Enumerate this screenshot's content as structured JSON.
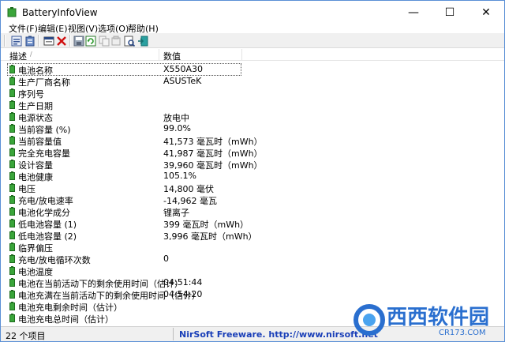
{
  "window": {
    "title": "BatteryInfoView"
  },
  "controls": {
    "minimize": "—",
    "maximize": "☐",
    "close": "✕"
  },
  "menu": [
    "文件(F)",
    "编辑(E)",
    "视图(V)",
    "选项(O)",
    "帮助(H)"
  ],
  "toolbar": {
    "icons": [
      "battery-info-icon",
      "battery-log-icon",
      "advanced-options-icon",
      "delete-icon",
      "save-icon",
      "refresh-icon",
      "copy-icon",
      "html-report-icon",
      "properties-icon",
      "exit-icon"
    ]
  },
  "columns": [
    "描述",
    "数值"
  ],
  "rows": [
    {
      "desc": "电池名称",
      "value": "X550A30"
    },
    {
      "desc": "生产厂商名称",
      "value": "ASUSTeK"
    },
    {
      "desc": "序列号",
      "value": ""
    },
    {
      "desc": "生产日期",
      "value": ""
    },
    {
      "desc": "电源状态",
      "value": "放电中"
    },
    {
      "desc": "当前容量 (%)",
      "value": "99.0%"
    },
    {
      "desc": "当前容量值",
      "value": "41,573 毫瓦时（mWh）"
    },
    {
      "desc": "完全充电容量",
      "value": "41,987 毫瓦时（mWh）"
    },
    {
      "desc": "设计容量",
      "value": "39,960 毫瓦时（mWh）"
    },
    {
      "desc": "电池健康",
      "value": "105.1%"
    },
    {
      "desc": "电压",
      "value": "14,800 毫伏"
    },
    {
      "desc": "充电/放电速率",
      "value": "-14,962 毫瓦"
    },
    {
      "desc": "电池化学成分",
      "value": "锂离子"
    },
    {
      "desc": "低电池容量 (1)",
      "value": "399 毫瓦时（mWh）"
    },
    {
      "desc": "低电池容量 (2)",
      "value": "3,996 毫瓦时（mWh）"
    },
    {
      "desc": "临界偏压",
      "value": ""
    },
    {
      "desc": "充电/放电循环次数",
      "value": "0"
    },
    {
      "desc": "电池温度",
      "value": ""
    },
    {
      "desc": "电池在当前活动下的剩余使用时间（估计）",
      "value": "04:51:44"
    },
    {
      "desc": "电池充满在当前活动下的剩余使用时间（估计）",
      "value": "04:54:20"
    },
    {
      "desc": "电池充电剩余时间（估计）",
      "value": ""
    },
    {
      "desc": "电池充电总时间（估计）",
      "value": ""
    }
  ],
  "status": {
    "count": "22 个项目",
    "credit": "NirSoft Freeware.  http://www.nirsoft.net"
  },
  "watermark": {
    "brand": "西西软件园",
    "site": "CR173.COM"
  },
  "colors": {
    "battery_green": "#3aa53a",
    "link_blue": "#1a3fb8",
    "watermark_blue": "#2a6fcf"
  }
}
